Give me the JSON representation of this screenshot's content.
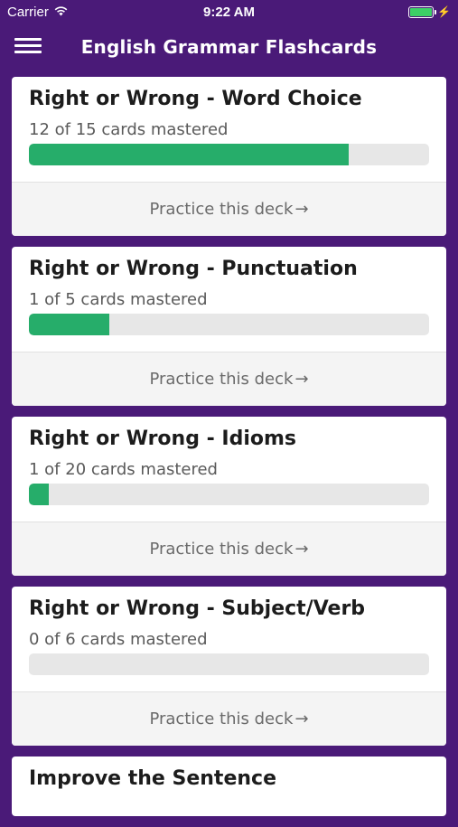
{
  "status_bar": {
    "carrier": "Carrier",
    "time": "9:22 AM",
    "battery_level": 1.0
  },
  "header": {
    "title": "English Grammar Flashcards",
    "menu_icon": "hamburger-menu-icon"
  },
  "colors": {
    "header_bg": "#4a1a78",
    "progress_fill": "#26ad6a",
    "progress_track": "#e7e7e7"
  },
  "decks": [
    {
      "title": "Right or Wrong - Word Choice",
      "mastered_text": "12 of 15 cards mastered",
      "progress": 0.8,
      "practice_label": "Practice this deck",
      "arrow": "→"
    },
    {
      "title": "Right or Wrong - Punctuation",
      "mastered_text": "1 of 5 cards mastered",
      "progress": 0.2,
      "practice_label": "Practice this deck",
      "arrow": "→"
    },
    {
      "title": "Right or Wrong - Idioms",
      "mastered_text": "1 of 20 cards mastered",
      "progress": 0.05,
      "practice_label": "Practice this deck",
      "arrow": "→"
    },
    {
      "title": "Right or Wrong - Subject/Verb",
      "mastered_text": "0 of 6 cards mastered",
      "progress": 0.0,
      "practice_label": "Practice this deck",
      "arrow": "→"
    },
    {
      "title": "Improve the Sentence"
    }
  ]
}
